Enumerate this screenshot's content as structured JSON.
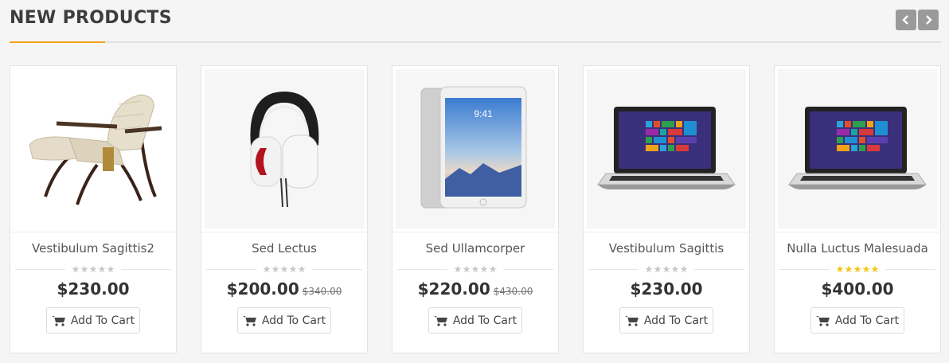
{
  "section": {
    "title": "NEW PRODUCTS",
    "nav": {
      "prev_icon": "chevron-left-icon",
      "next_icon": "chevron-right-icon"
    },
    "accent_color": "#f0a21a"
  },
  "products": [
    {
      "name": "Vestibulum Sagittis2",
      "price": "$230.00",
      "old_price": "",
      "rating": 0,
      "button_label": "Add To Cart",
      "image": "lounge-chair"
    },
    {
      "name": "Sed Lectus",
      "price": "$200.00",
      "old_price": "$340.00",
      "rating": 0,
      "button_label": "Add To Cart",
      "image": "headphones"
    },
    {
      "name": "Sed Ullamcorper",
      "price": "$220.00",
      "old_price": "$430.00",
      "rating": 0,
      "button_label": "Add To Cart",
      "image": "tablet"
    },
    {
      "name": "Vestibulum Sagittis",
      "price": "$230.00",
      "old_price": "",
      "rating": 0,
      "button_label": "Add To Cart",
      "image": "laptop"
    },
    {
      "name": "Nulla Luctus Malesuada",
      "price": "$400.00",
      "old_price": "",
      "rating": 5,
      "button_label": "Add To Cart",
      "image": "laptop"
    }
  ]
}
